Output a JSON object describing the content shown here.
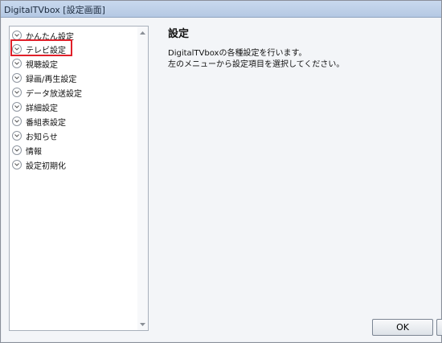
{
  "window": {
    "title": "DigitalTVbox [設定画面]"
  },
  "sidebar": {
    "items": [
      {
        "label": "かんたん設定"
      },
      {
        "label": "テレビ設定"
      },
      {
        "label": "視聴設定"
      },
      {
        "label": "録画/再生設定"
      },
      {
        "label": "データ放送設定"
      },
      {
        "label": "詳細設定"
      },
      {
        "label": "番組表設定"
      },
      {
        "label": "お知らせ"
      },
      {
        "label": "情報"
      },
      {
        "label": "設定初期化"
      }
    ],
    "highlighted_item": "テレビ設定"
  },
  "main": {
    "heading": "設定",
    "description_lines": [
      "DigitalTVboxの各種設定を行います。",
      "左のメニューから設定項目を選択してください。"
    ]
  },
  "buttons": {
    "ok_label": "OK"
  },
  "colors": {
    "highlight_border": "#e0202a",
    "titlebar": "#c9d9ee"
  },
  "icons": {
    "menu_item": "chevron-down-circle-icon",
    "scroll_up": "scroll-up-arrow-icon",
    "scroll_down": "scroll-down-arrow-icon"
  }
}
